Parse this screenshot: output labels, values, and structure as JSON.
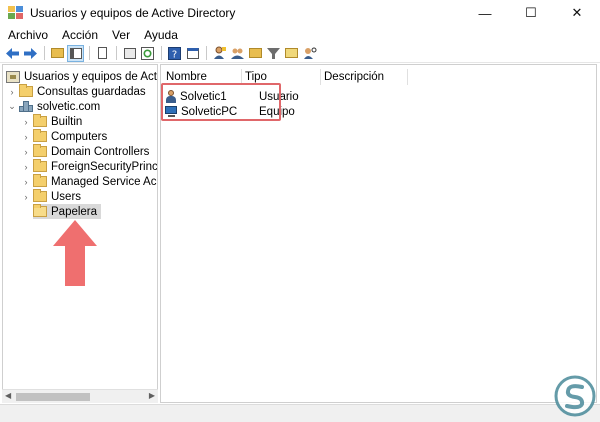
{
  "window": {
    "title": "Usuarios y equipos de Active Directory",
    "controls": {
      "minimize": "—",
      "maximize": "☐",
      "close": "✕"
    }
  },
  "menu": [
    "Archivo",
    "Acción",
    "Ver",
    "Ayuda"
  ],
  "toolbar": {
    "icons": [
      "back-arrow-icon",
      "forward-arrow-icon",
      "up-folder-icon",
      "show-tree-icon",
      "properties-icon",
      "refresh-icon",
      "export-list-icon",
      "help-icon",
      "console-icon",
      "create-user-icon",
      "create-group-icon",
      "create-ou-icon",
      "filter-icon",
      "add-to-group-icon",
      "find-icon"
    ]
  },
  "tree": {
    "root": "Usuarios y equipos de Active Dir",
    "items": [
      {
        "label": "Consultas guardadas",
        "level": 1,
        "expandable": true
      },
      {
        "label": "solvetic.com",
        "level": 1,
        "expandable": true,
        "expanded": true
      },
      {
        "label": "Builtin",
        "level": 2,
        "expandable": true
      },
      {
        "label": "Computers",
        "level": 2,
        "expandable": true
      },
      {
        "label": "Domain Controllers",
        "level": 2,
        "expandable": true
      },
      {
        "label": "ForeignSecurityPrincipals",
        "level": 2,
        "expandable": true
      },
      {
        "label": "Managed Service Accour",
        "level": 2,
        "expandable": true
      },
      {
        "label": "Users",
        "level": 2,
        "expandable": true
      },
      {
        "label": "Papelera",
        "level": 2,
        "expandable": false,
        "selected": true
      }
    ]
  },
  "list": {
    "columns": [
      "Nombre",
      "Tipo",
      "Descripción"
    ],
    "rows": [
      {
        "name": "Solvetic1",
        "type": "Usuario",
        "description": "",
        "icon": "user-icon"
      },
      {
        "name": "SolveticPC",
        "type": "Equipo",
        "description": "",
        "icon": "computer-icon"
      }
    ]
  },
  "colors": {
    "highlight_box": "#e0676a",
    "annotation_arrow": "#ef6f6f",
    "selection": "#d9d9d9"
  }
}
